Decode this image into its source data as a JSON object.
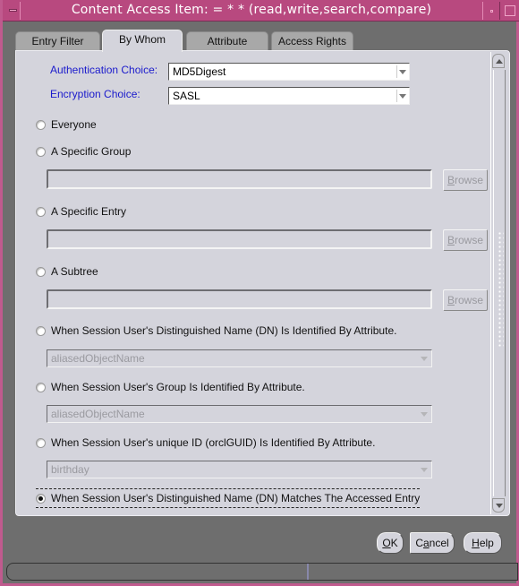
{
  "window": {
    "title": "Content Access Item:  = * * (read,write,search,compare)"
  },
  "tabs": [
    {
      "label": "Entry Filter",
      "active": false
    },
    {
      "label": "By Whom",
      "active": true
    },
    {
      "label": "Attribute",
      "active": false
    },
    {
      "label": "Access Rights",
      "active": false
    }
  ],
  "form": {
    "authentication": {
      "label": "Authentication Choice:",
      "value": "MD5Digest"
    },
    "encryption": {
      "label": "Encryption Choice:",
      "value": "SASL"
    },
    "options": {
      "everyone": {
        "label": "Everyone",
        "checked": false
      },
      "specific_group": {
        "label": "A Specific Group",
        "checked": false,
        "value": "",
        "browse": "Browse",
        "browse_mnemonic": "B",
        "browse_rest": "rowse"
      },
      "specific_entry": {
        "label": "A Specific Entry",
        "checked": false,
        "value": "",
        "browse": "Browse",
        "browse_mnemonic": "B",
        "browse_rest": "rowse"
      },
      "subtree": {
        "label": "A Subtree",
        "checked": false,
        "value": "",
        "browse": "Browse",
        "browse_mnemonic": "B",
        "browse_rest": "rowse"
      },
      "dn_by_attr": {
        "label": "When Session User's Distinguished Name (DN) Is Identified By Attribute.",
        "checked": false,
        "value": "aliasedObjectName"
      },
      "group_by_attr": {
        "label": "When Session User's Group Is Identified By Attribute.",
        "checked": false,
        "value": "aliasedObjectName"
      },
      "guid_by_attr": {
        "label": "When Session User's unique ID (orclGUID) Is Identified By Attribute.",
        "checked": false,
        "value": "birthday"
      },
      "dn_matches": {
        "label": "When Session User's Distinguished Name (DN) Matches The Accessed Entry",
        "checked": true
      }
    }
  },
  "buttons": {
    "ok": {
      "mnemonic": "O",
      "rest": "K"
    },
    "cancel": {
      "pre": "C",
      "mnemonic": "a",
      "rest": "ncel"
    },
    "help": {
      "mnemonic": "H",
      "rest": "elp"
    }
  },
  "colors": {
    "titlebar": "#b8497f",
    "panel": "#d4d4dc",
    "label_blue": "#1a1acc"
  }
}
